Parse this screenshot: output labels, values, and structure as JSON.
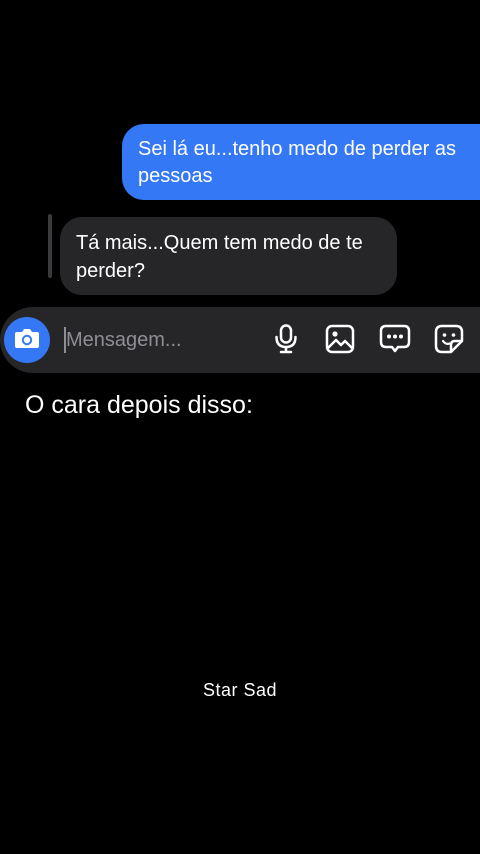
{
  "chat": {
    "sent_message": "Sei lá eu...tenho medo de perder as pessoas",
    "received_message": "Tá mais...Quem tem medo de te perder?"
  },
  "composer": {
    "placeholder": "Mensagem...",
    "icons": [
      "camera-icon",
      "microphone-icon",
      "gallery-icon",
      "chat-bubble-icon",
      "sticker-icon"
    ]
  },
  "caption": "O cara depois disso:",
  "watermark": "Star Sad",
  "colors": {
    "background": "#000000",
    "sent_bubble": "#3478f6",
    "received_bubble": "#262629",
    "composer_bg": "#262629",
    "camera_button": "#3478f6"
  }
}
